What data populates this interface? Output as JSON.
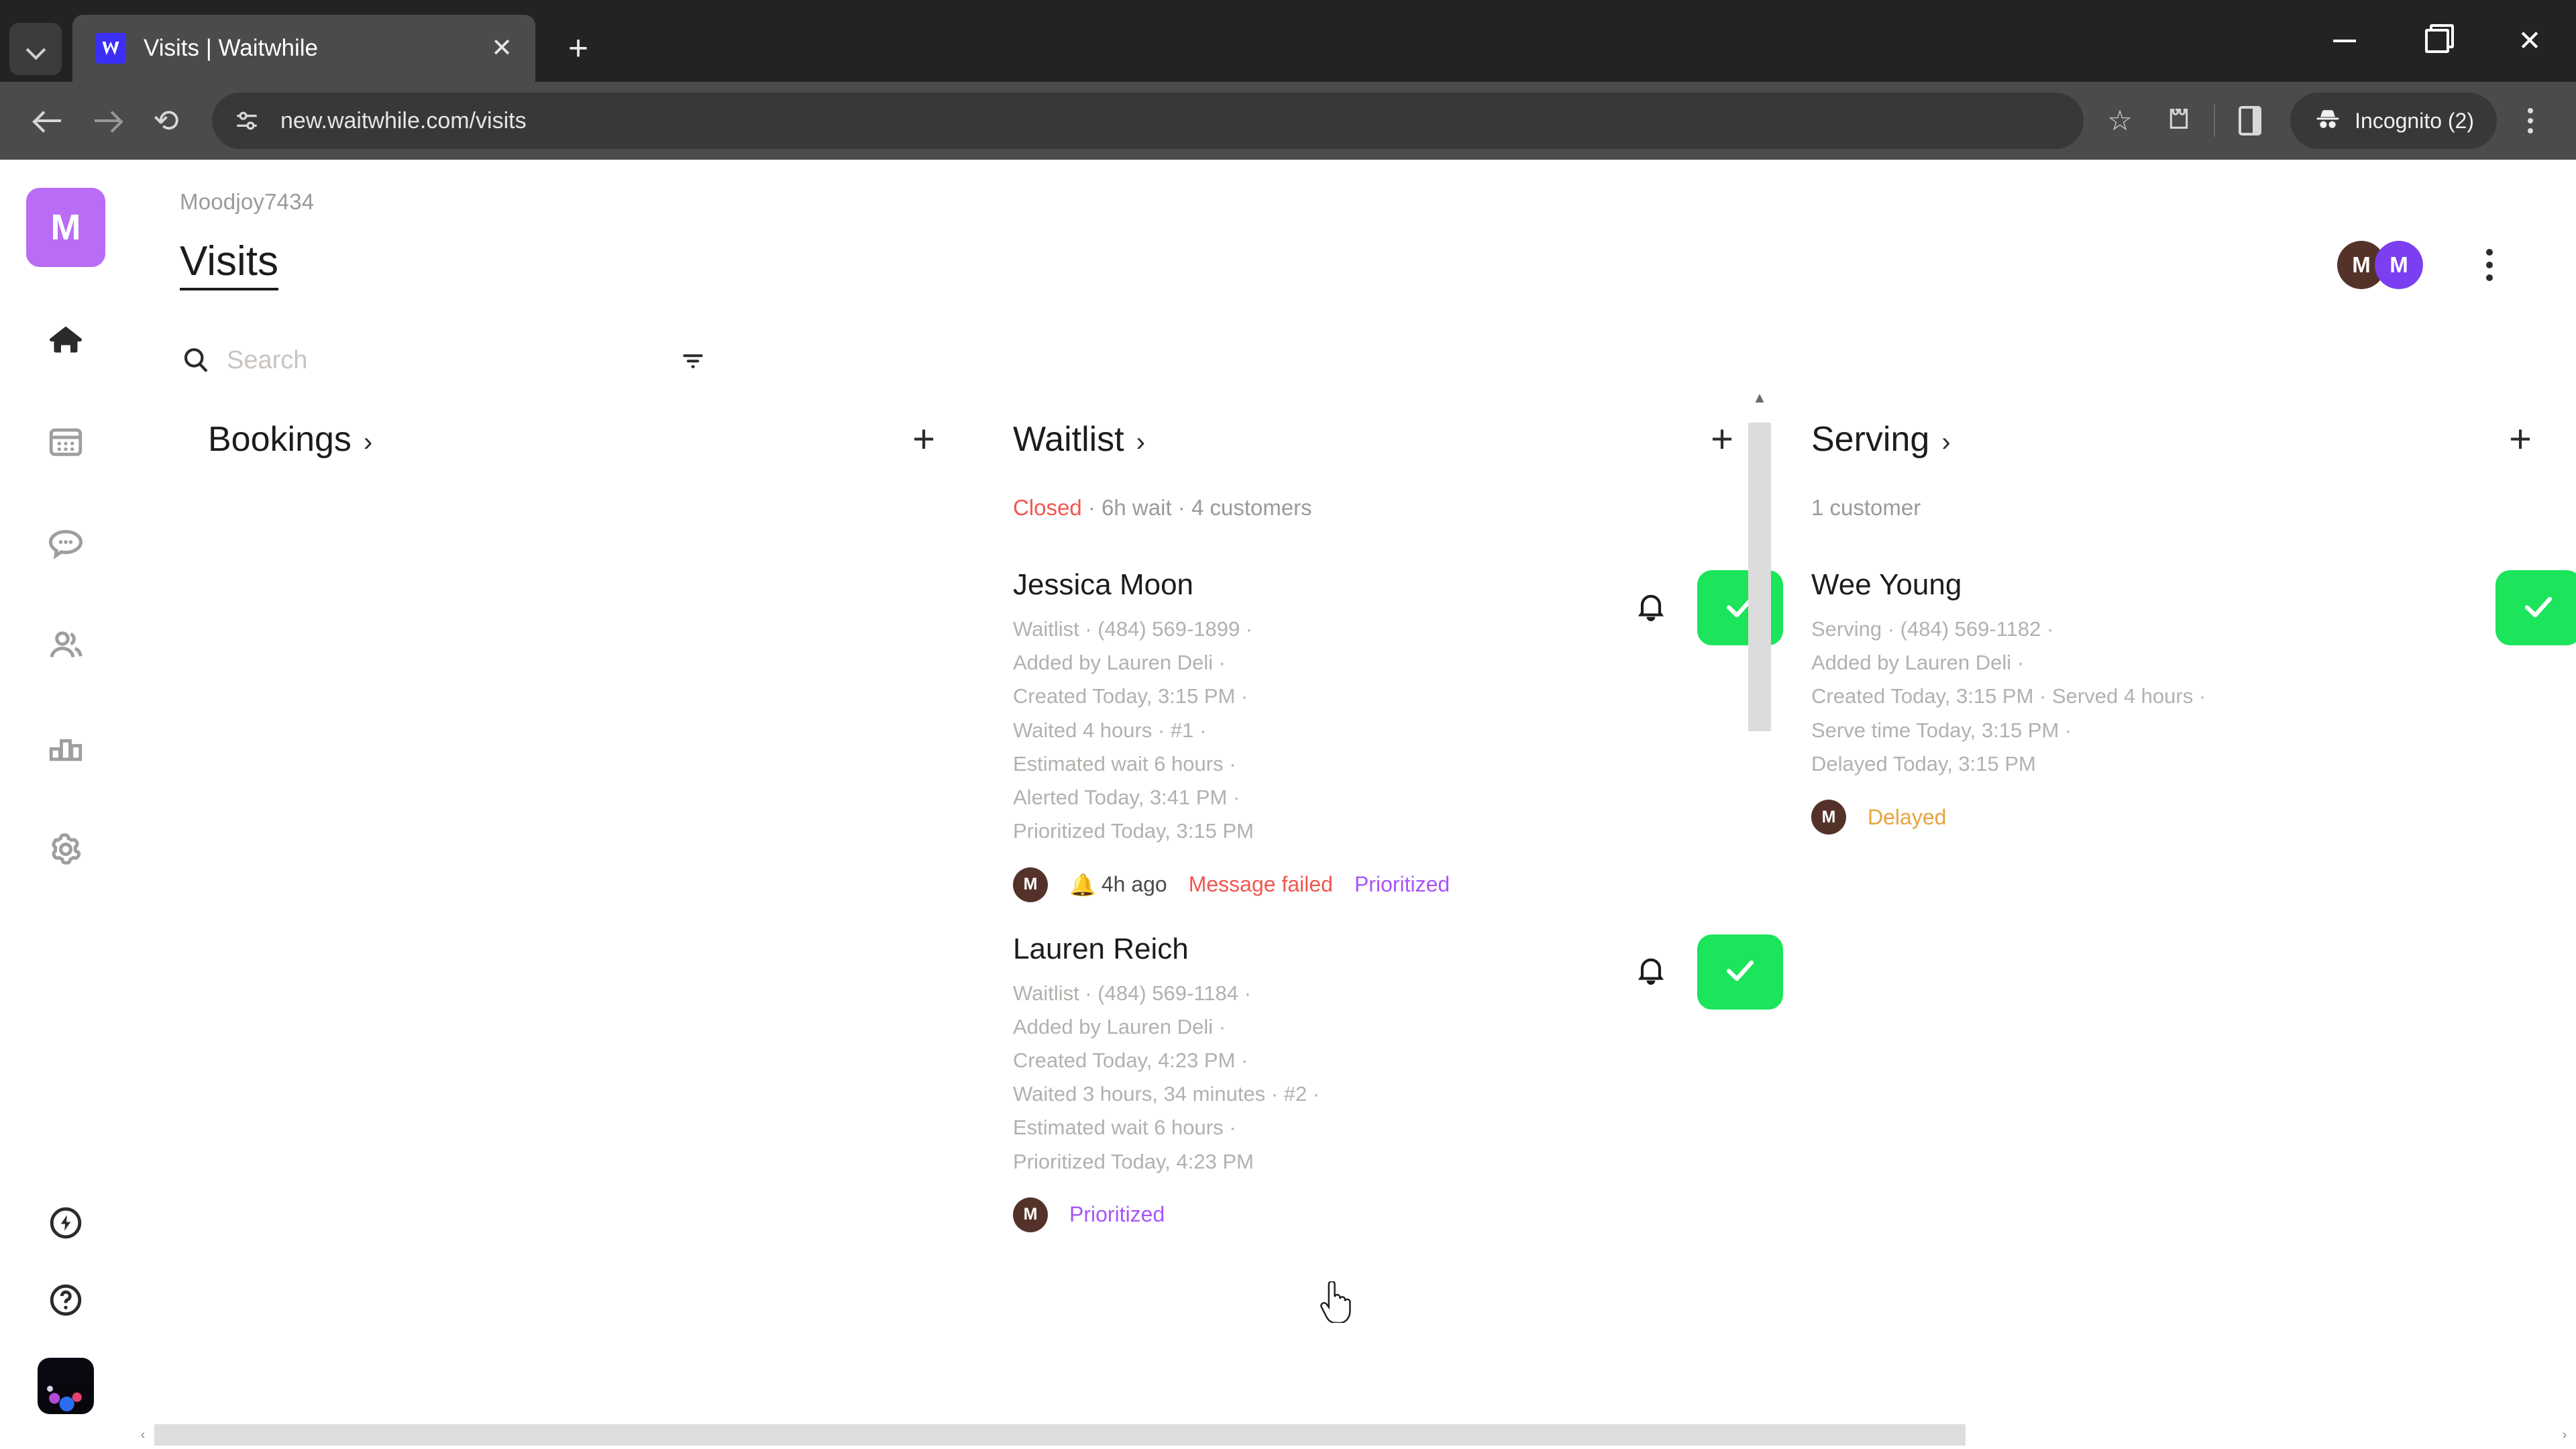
{
  "browser": {
    "tab": {
      "title": "Visits | Waitwhile",
      "favicon": "waitwhile-logo-icon",
      "close_label": "✕"
    },
    "new_tab_label": "+",
    "tab_search_icon": "chevron-down-icon",
    "window_controls": {
      "minimize": "minimize-icon",
      "maximize": "maximize-icon",
      "close": "✕"
    },
    "nav": {
      "back": "back-arrow-icon",
      "forward": "forward-arrow-icon",
      "reload": "⟳"
    },
    "omnibox": {
      "site_settings_icon": "tune-icon",
      "url": "new.waitwhile.com/visits",
      "bookmark_icon": "star-icon",
      "extensions_icon": "extensions-icon",
      "side_panel_icon": "side-panel-icon"
    },
    "profile": {
      "label": "Incognito (2)",
      "icon": "incognito-icon"
    },
    "menu_icon": "kebab-menu-icon"
  },
  "sidebar": {
    "brand": {
      "initial": "M",
      "color": "#b96cf5"
    },
    "items": [
      {
        "name": "home",
        "icon": "home-icon",
        "active": true
      },
      {
        "name": "calendar",
        "icon": "calendar-icon",
        "active": false
      },
      {
        "name": "messages",
        "icon": "chat-bubble-icon",
        "active": false
      },
      {
        "name": "customers",
        "icon": "people-icon",
        "active": false
      },
      {
        "name": "analytics",
        "icon": "bar-chart-icon",
        "active": false
      },
      {
        "name": "settings",
        "icon": "gear-icon",
        "active": false
      }
    ],
    "bottom_items": [
      {
        "name": "whats-new",
        "icon": "lightning-circle-icon"
      },
      {
        "name": "help",
        "icon": "question-circle-icon"
      },
      {
        "name": "user-avatar",
        "icon": "avatar-image"
      }
    ]
  },
  "header": {
    "breadcrumb": "Moodjoy7434",
    "title": "Visits",
    "avatars": [
      {
        "initial": "M",
        "color": "#553229"
      },
      {
        "initial": "M",
        "color": "#7b3ef0"
      }
    ],
    "menu_icon": "kebab-menu-icon"
  },
  "search": {
    "placeholder": "Search",
    "value": "",
    "search_icon": "search-icon",
    "filter_icon": "filter-icon"
  },
  "board": {
    "columns": [
      {
        "title": "Bookings",
        "chevron": "›",
        "add_label": "+",
        "meta": "",
        "cards": []
      },
      {
        "title": "Waitlist",
        "chevron": "›",
        "add_label": "+",
        "meta_status": "Closed",
        "meta_rest": " · 6h wait · 4 customers",
        "cards": [
          {
            "name": "Jessica Moon",
            "lines": [
              "Waitlist · (484) 569-1899 ·",
              "Added by Lauren Deli ·",
              "Created Today, 3:15 PM ·",
              "Waited 4 hours · #1 ·",
              "Estimated wait 6 hours ·",
              "Alerted Today, 3:41 PM ·",
              "Prioritized Today, 3:15 PM"
            ],
            "avatar": {
              "initial": "M",
              "color": "#553229"
            },
            "badges": [
              {
                "text": "4h ago",
                "kind": "neutral",
                "icon": "bell-icon"
              },
              {
                "text": "Message failed",
                "kind": "failed",
                "icon": ""
              },
              {
                "text": "Prioritized",
                "kind": "prio",
                "icon": ""
              }
            ],
            "bell_icon": "bell-icon",
            "check_icon": "check-icon"
          },
          {
            "name": "Lauren Reich",
            "lines": [
              "Waitlist · (484) 569-1184 ·",
              "Added by Lauren Deli ·",
              "Created Today, 4:23 PM ·",
              "Waited 3 hours, 34 minutes · #2 ·",
              "Estimated wait 6 hours ·",
              "Prioritized Today, 4:23 PM"
            ],
            "avatar": {
              "initial": "M",
              "color": "#553229"
            },
            "badges": [
              {
                "text": "Prioritized",
                "kind": "prio",
                "icon": ""
              }
            ],
            "bell_icon": "bell-icon",
            "check_icon": "check-icon"
          }
        ],
        "scrollbar": {
          "up": "▲",
          "down": "▼"
        }
      },
      {
        "title": "Serving",
        "chevron": "›",
        "add_label": "+",
        "meta": "1 customer",
        "cards": [
          {
            "name": "Wee Young",
            "lines": [
              "Serving · (484) 569-1182 ·",
              "Added by Lauren Deli ·",
              "Created Today, 3:15 PM · Served 4 hours ·",
              "Serve time Today, 3:15 PM ·",
              "Delayed Today, 3:15 PM"
            ],
            "avatar": {
              "initial": "M",
              "color": "#553229"
            },
            "badges": [
              {
                "text": "Delayed",
                "kind": "delayed",
                "icon": ""
              }
            ],
            "check_icon": "check-icon"
          }
        ]
      }
    ]
  },
  "scrollbars": {
    "horizontal": {
      "left_arrow": "‹",
      "right_arrow": "›"
    }
  },
  "colors": {
    "accent_green": "#1ce45b",
    "brand_purple": "#b96cf5",
    "error_red": "#f1574f",
    "prioritized_purple": "#a855f7",
    "delayed_orange": "#e8a33d"
  }
}
